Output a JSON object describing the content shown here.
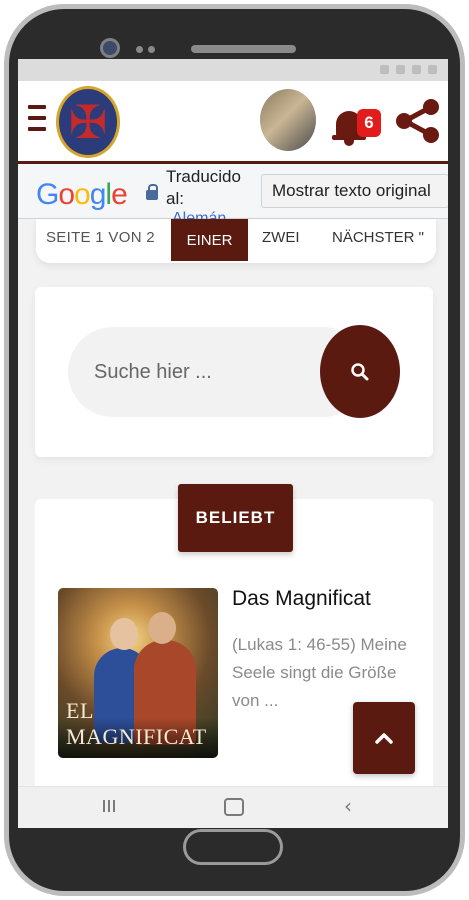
{
  "header": {
    "menu_icon": "hamburger-icon",
    "logo_icon": "cross-emblem-icon",
    "notifications_count": "6",
    "bell_icon": "bell-icon",
    "share_icon": "share-icon"
  },
  "translate": {
    "brand": "Google",
    "label": "Traducido al:",
    "language": "Alemán",
    "show_original": "Mostrar texto original"
  },
  "pagination": {
    "info": "SEITE 1 VON 2",
    "current": "EINER",
    "two": "ZWEI",
    "next": "NÄCHSTER \""
  },
  "search": {
    "placeholder": "Suche hier ...",
    "icon": "search-icon"
  },
  "popular": {
    "button_label": "BELIEBT",
    "post": {
      "title": "Das Magnificat",
      "excerpt": "(Lukas 1: 46-55) Meine Seele singt die Größe von ...",
      "image_caption": "EL MAGNIFICAT"
    }
  },
  "navbar": {
    "recents_icon": "recents-icon",
    "home_icon": "home-icon",
    "back_icon": "back-chevron-icon"
  },
  "colors": {
    "brand": "#5b1a10",
    "badge": "#e21b1b"
  }
}
